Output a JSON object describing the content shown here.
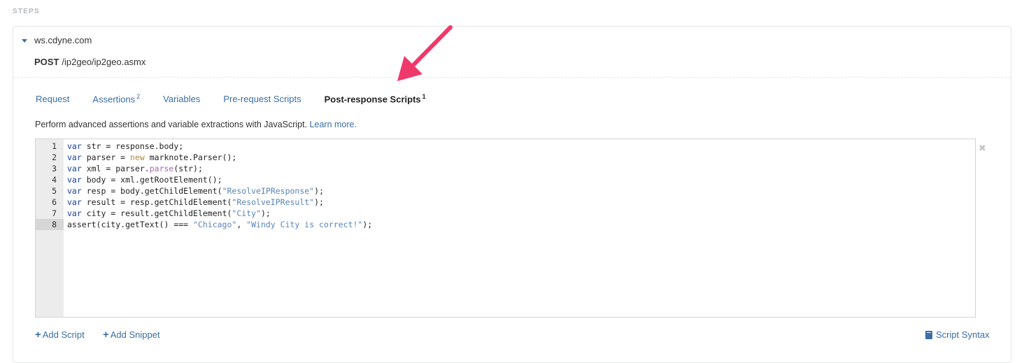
{
  "section_label": "STEPS",
  "step": {
    "host": "ws.cdyne.com",
    "method": "POST",
    "path": "/ip2geo/ip2geo.asmx"
  },
  "tabs": [
    {
      "label": "Request",
      "count": ""
    },
    {
      "label": "Assertions",
      "count": "2"
    },
    {
      "label": "Variables",
      "count": ""
    },
    {
      "label": "Pre-request Scripts",
      "count": ""
    },
    {
      "label": "Post-response Scripts",
      "count": "1",
      "active": true
    }
  ],
  "description": {
    "text": "Perform advanced assertions and variable extractions with JavaScript.",
    "link": "Learn more."
  },
  "editor": {
    "current_line": 8,
    "lines": [
      "var str = response.body;",
      "var parser = new marknote.Parser();",
      "var xml = parser.parse(str);",
      "var body = xml.getRootElement();",
      "var resp = body.getChildElement(\"ResolveIPResponse\");",
      "var result = resp.getChildElement(\"ResolveIPResult\");",
      "var city = result.getChildElement(\"City\");",
      "assert(city.getText() === \"Chicago\", \"Windy City is correct!\");"
    ]
  },
  "footer": {
    "add_script": "Add Script",
    "add_snippet": "Add Snippet",
    "script_syntax": "Script Syntax"
  },
  "icons": {
    "close": "close-icon",
    "book": "book-icon",
    "arrow_color": "#f0396b"
  }
}
